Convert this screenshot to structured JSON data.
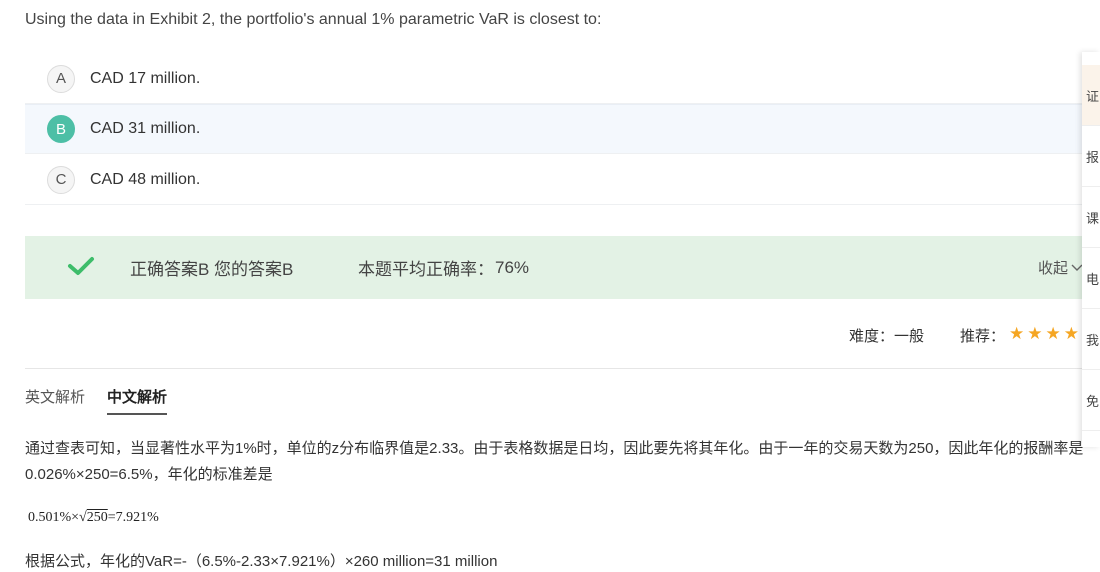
{
  "question": {
    "text": "Using the data in Exhibit 2, the portfolio's annual 1% parametric VaR is closest to:"
  },
  "options": [
    {
      "letter": "A",
      "text": "CAD 17 million."
    },
    {
      "letter": "B",
      "text": "CAD 31 million."
    },
    {
      "letter": "C",
      "text": "CAD 48 million."
    }
  ],
  "selected_option": "B",
  "answer_bar": {
    "answer_text": "正确答案B 您的答案B",
    "rate_label": "本题平均正确率：",
    "rate_value": "76%",
    "collapse_label": "收起"
  },
  "meta": {
    "difficulty": "难度：一般",
    "recommend_label": "推荐：",
    "stars": "★★★★",
    "star_rating": 4
  },
  "tabs": [
    {
      "label": "英文解析",
      "active": false
    },
    {
      "label": "中文解析",
      "active": true
    }
  ],
  "explanation": {
    "paragraph1": "通过查表可知，当显著性水平为1%时，单位的z分布临界值是2.33。由于表格数据是日均，因此要先将其年化。由于一年的交易天数为250，因此年化的报酬率是0.026%×250=6.5%，年化的标准差是",
    "formula_prefix": "0.501%×√",
    "formula_radicand": "250",
    "formula_suffix": "=7.921%",
    "paragraph2": "根据公式，年化的VaR=-（6.5%-2.33×7.921%）×260 million=31 million"
  },
  "side_panel": {
    "items": [
      "证",
      "报",
      "课",
      "电",
      "我",
      "免"
    ]
  },
  "colors": {
    "selected_badge": "#4dbfa6",
    "answer_bar_bg": "#e3f2e5",
    "check_green": "#3dbd6a",
    "star": "#f5a623"
  },
  "icons": {
    "check": "check-icon",
    "collapse": "chevron-down-icon"
  }
}
